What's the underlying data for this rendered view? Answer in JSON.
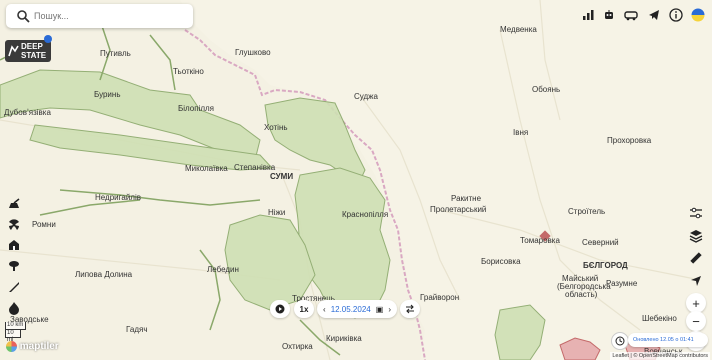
{
  "search": {
    "placeholder": "Пошук..."
  },
  "logo": {
    "line1": "DEEP",
    "line2": "STATE"
  },
  "top_icons": [
    "bar-chart-icon",
    "robot-icon",
    "vehicle-icon",
    "telegram-icon",
    "info-icon",
    "ukraine-flag-icon"
  ],
  "left_icons": [
    "artillery-icon",
    "radiation-icon",
    "building-icon",
    "explosion-icon",
    "missile-icon",
    "fire-icon"
  ],
  "right_icons": [
    "filter-icon",
    "layers-icon",
    "ruler-icon",
    "locate-icon"
  ],
  "zoom": {
    "in": "+",
    "out": "−",
    "reset": "●"
  },
  "timebar": {
    "speed": "1x",
    "date": "12.05.2024"
  },
  "scale": {
    "km": "10 km",
    "mi": "10 mi"
  },
  "maptiler": "maptiler",
  "updated": "Оновлено 12.05 о 01:41",
  "attribution": "Leaflet | © OpenStreetMap contributors",
  "places": [
    {
      "name": "Медвенка",
      "cls": "city"
    },
    {
      "name": "Глушково",
      "cls": "city"
    },
    {
      "name": "Путивль",
      "cls": "city"
    },
    {
      "name": "Тьоткіно",
      "cls": "city"
    },
    {
      "name": "Буринь",
      "cls": "city"
    },
    {
      "name": "Білопілля",
      "cls": "city"
    },
    {
      "name": "Суджа",
      "cls": "city"
    },
    {
      "name": "Обоянь",
      "cls": "city"
    },
    {
      "name": "Дубовʼязівка",
      "cls": "city"
    },
    {
      "name": "Хотінь",
      "cls": "city"
    },
    {
      "name": "Івня",
      "cls": "city"
    },
    {
      "name": "Прохоровка",
      "cls": "city"
    },
    {
      "name": "Миколаївка",
      "cls": "city"
    },
    {
      "name": "Степанівка",
      "cls": "city"
    },
    {
      "name": "СУМИ",
      "cls": "big"
    },
    {
      "name": "Ракитне",
      "cls": "city"
    },
    {
      "name": "Недригайлів",
      "cls": "city"
    },
    {
      "name": "Пролетарський",
      "cls": "city"
    },
    {
      "name": "Строїтель",
      "cls": "city"
    },
    {
      "name": "Ромни",
      "cls": "city"
    },
    {
      "name": "Ніжи",
      "cls": "city"
    },
    {
      "name": "Краснопілля",
      "cls": "city"
    },
    {
      "name": "Томаровка",
      "cls": "city"
    },
    {
      "name": "Северний",
      "cls": "city"
    },
    {
      "name": "Борисовка",
      "cls": "city"
    },
    {
      "name": "БЄЛГОРОД",
      "cls": "big"
    },
    {
      "name": "Майський",
      "cls": "city"
    },
    {
      "name": "(Белгородська",
      "cls": "city"
    },
    {
      "name": "область)",
      "cls": "city"
    },
    {
      "name": "Разумне",
      "cls": "city"
    },
    {
      "name": "Липова Долина",
      "cls": "city"
    },
    {
      "name": "Лебедин",
      "cls": "city"
    },
    {
      "name": "Грайворон",
      "cls": "city"
    },
    {
      "name": "Тростянець",
      "cls": "city"
    },
    {
      "name": "Заводське",
      "cls": "city"
    },
    {
      "name": "Гадяч",
      "cls": "city"
    },
    {
      "name": "Шебекіно",
      "cls": "city"
    },
    {
      "name": "Охтирка",
      "cls": "city"
    },
    {
      "name": "Кириківка",
      "cls": "city"
    },
    {
      "name": "Вовчанськ",
      "cls": "city"
    }
  ]
}
